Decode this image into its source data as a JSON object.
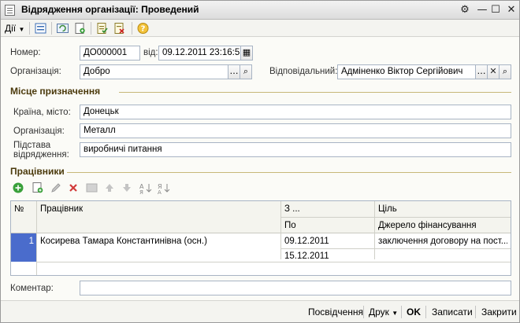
{
  "window": {
    "title": "Відрядження організації: Проведений"
  },
  "toolbar": {
    "actions_label": "Дії"
  },
  "header": {
    "number_label": "Номер:",
    "number_value": "ДО000001",
    "date_label": "від:",
    "date_value": "09.12.2011 23:16:57",
    "org_label": "Організація:",
    "org_value": "Добро",
    "responsible_label": "Відповідальний:",
    "responsible_value": "Адміненко Віктор Сергійович"
  },
  "destination": {
    "title": "Місце призначення",
    "country_label": "Країна, місто:",
    "country_value": "Донецьк",
    "org_label": "Організація:",
    "org_value": "Металл",
    "basis_label": "Підстава відрядження:",
    "basis_value": "виробничі питання"
  },
  "workers": {
    "title": "Працівники",
    "columns": {
      "num": "№",
      "worker": "Працівник",
      "from": "З ...",
      "to": "По",
      "goal": "Ціль",
      "source": "Джерело фінансування"
    },
    "rows": [
      {
        "num": "1",
        "worker": "Косирева Тамара Константинівна (осн.)",
        "from": "09.12.2011",
        "to": "15.12.2011",
        "goal": "заключення договору на пост...",
        "source": ""
      }
    ]
  },
  "comment": {
    "label": "Коментар:",
    "value": ""
  },
  "footer": {
    "certificate": "Посвідчення",
    "print": "Друк",
    "ok": "OK",
    "save": "Записати",
    "close": "Закрити"
  }
}
